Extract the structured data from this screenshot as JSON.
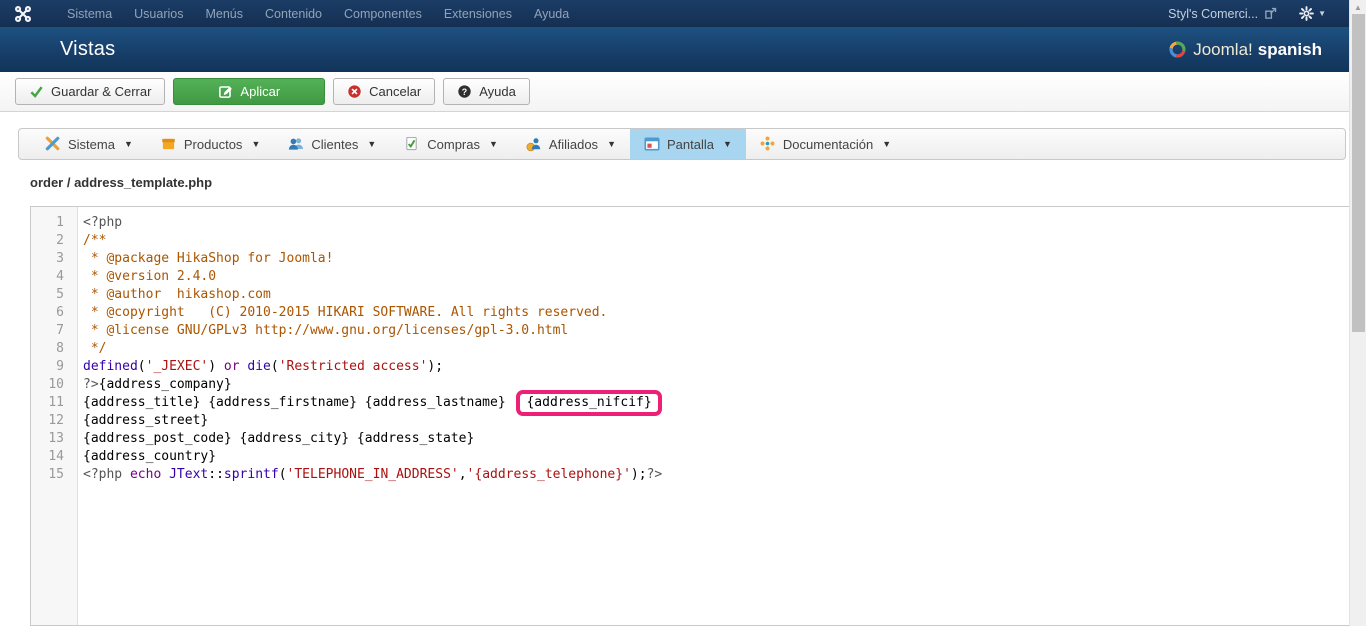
{
  "topbar": {
    "menu": [
      "Sistema",
      "Usuarios",
      "Menús",
      "Contenido",
      "Componentes",
      "Extensiones",
      "Ayuda"
    ],
    "site_name": "Styl's Comerci..."
  },
  "header": {
    "title": "Vistas",
    "brand_name": "Joomla!",
    "brand_suffix": "spanish"
  },
  "toolbar": {
    "buttons": [
      {
        "label": "Guardar & Cerrar",
        "style": "default",
        "icon": "check"
      },
      {
        "label": "Aplicar",
        "style": "success",
        "icon": "edit"
      },
      {
        "label": "Cancelar",
        "style": "default",
        "icon": "cancel"
      },
      {
        "label": "Ayuda",
        "style": "default",
        "icon": "help"
      }
    ]
  },
  "tabs": [
    {
      "label": "Sistema",
      "icon": "tools",
      "active": false
    },
    {
      "label": "Productos",
      "icon": "box",
      "active": false
    },
    {
      "label": "Clientes",
      "icon": "users",
      "active": false
    },
    {
      "label": "Compras",
      "icon": "orders",
      "active": false
    },
    {
      "label": "Afiliados",
      "icon": "affiliate",
      "active": false
    },
    {
      "label": "Pantalla",
      "icon": "display",
      "active": true
    },
    {
      "label": "Documentación",
      "icon": "docs",
      "active": false
    }
  ],
  "breadcrumb": "order / address_template.php",
  "editor": {
    "highlighted_token": "{address_nifcif}",
    "lines": [
      {
        "no": 1,
        "seg": [
          [
            "m",
            "<?php"
          ]
        ]
      },
      {
        "no": 2,
        "seg": [
          [
            "c",
            "/**"
          ]
        ]
      },
      {
        "no": 3,
        "seg": [
          [
            "c",
            " * @package HikaShop for Joomla!"
          ]
        ]
      },
      {
        "no": 4,
        "seg": [
          [
            "c",
            " * @version 2.4.0"
          ]
        ]
      },
      {
        "no": 5,
        "seg": [
          [
            "c",
            " * @author  hikashop.com"
          ]
        ]
      },
      {
        "no": 6,
        "seg": [
          [
            "c",
            " * @copyright   (C) 2010-2015 HIKARI SOFTWARE. All rights reserved."
          ]
        ]
      },
      {
        "no": 7,
        "seg": [
          [
            "c",
            " * @license GNU/GPLv3 http://www.gnu.org/licenses/gpl-3.0.html"
          ]
        ]
      },
      {
        "no": 8,
        "seg": [
          [
            "c",
            " */"
          ]
        ]
      },
      {
        "no": 9,
        "seg": [
          [
            "b",
            "defined"
          ],
          [
            "p",
            "("
          ],
          [
            "s",
            "'_JEXEC'"
          ],
          [
            "p",
            ") "
          ],
          [
            "k",
            "or"
          ],
          [
            "p",
            " "
          ],
          [
            "b",
            "die"
          ],
          [
            "p",
            "("
          ],
          [
            "s",
            "'Restricted access'"
          ],
          [
            "p",
            ");"
          ]
        ]
      },
      {
        "no": 10,
        "seg": [
          [
            "m",
            "?>"
          ],
          [
            "p",
            "{address_company}"
          ]
        ]
      },
      {
        "no": 11,
        "seg": [
          [
            "p",
            "{address_title} {address_firstname} {address_lastname}"
          ],
          [
            "x",
            "{address_nifcif}"
          ]
        ]
      },
      {
        "no": 12,
        "seg": [
          [
            "p",
            "{address_street}"
          ]
        ]
      },
      {
        "no": 13,
        "seg": [
          [
            "p",
            "{address_post_code} {address_city} {address_state}"
          ]
        ]
      },
      {
        "no": 14,
        "seg": [
          [
            "p",
            "{address_country}"
          ]
        ]
      },
      {
        "no": 15,
        "seg": [
          [
            "m",
            "<?php"
          ],
          [
            "p",
            " "
          ],
          [
            "k",
            "echo"
          ],
          [
            "p",
            " "
          ],
          [
            "b",
            "JText"
          ],
          [
            "p",
            "::"
          ],
          [
            "b",
            "sprintf"
          ],
          [
            "p",
            "("
          ],
          [
            "s",
            "'TELEPHONE_IN_ADDRESS'"
          ],
          [
            "p",
            ","
          ],
          [
            "s",
            "'{address_telephone}'"
          ],
          [
            "p",
            ");"
          ],
          [
            "m",
            "?>"
          ]
        ]
      }
    ]
  },
  "colors": {
    "highlight_box": "#ec2077",
    "active_tab": "#a8d5ef",
    "success_button": "#46a546",
    "syntax_comment": "#aa5500",
    "syntax_string": "#aa1111",
    "syntax_keyword": "#770088",
    "syntax_builtin": "#3300aa",
    "syntax_meta": "#555555"
  }
}
